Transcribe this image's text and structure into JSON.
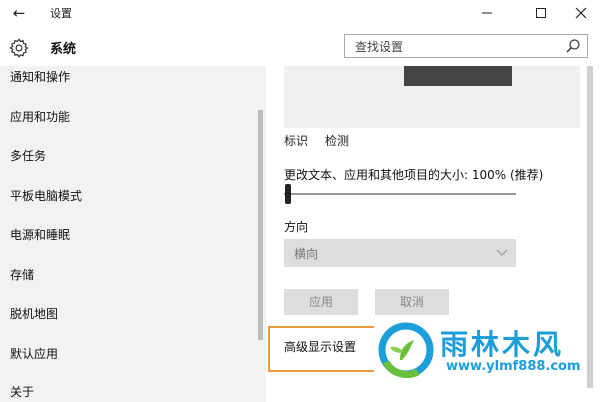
{
  "window": {
    "title": "设置",
    "back_icon": "←"
  },
  "header": {
    "section_title": "系统",
    "search_placeholder": "查找设置"
  },
  "sidebar": {
    "items": [
      {
        "label": "通知和操作"
      },
      {
        "label": "应用和功能"
      },
      {
        "label": "多任务"
      },
      {
        "label": "平板电脑模式"
      },
      {
        "label": "电源和睡眠"
      },
      {
        "label": "存储"
      },
      {
        "label": "脱机地图"
      },
      {
        "label": "默认应用"
      },
      {
        "label": "关于"
      }
    ]
  },
  "display": {
    "identify_link": "标识",
    "detect_link": "检测",
    "scale_label": "更改文本、应用和其他项目的大小: 100% (推荐)",
    "scale_value": 100,
    "orientation_label": "方向",
    "orientation_value": "横向",
    "apply_button": "应用",
    "cancel_button": "取消",
    "advanced_link": "高级显示设置"
  },
  "watermark": {
    "brand": "雨林木风",
    "url": "www.ylmf888.com",
    "color": "#1c9ed8"
  },
  "colors": {
    "highlight_border": "#ec9a3f",
    "sidebar_bg": "#f2f2f2"
  }
}
